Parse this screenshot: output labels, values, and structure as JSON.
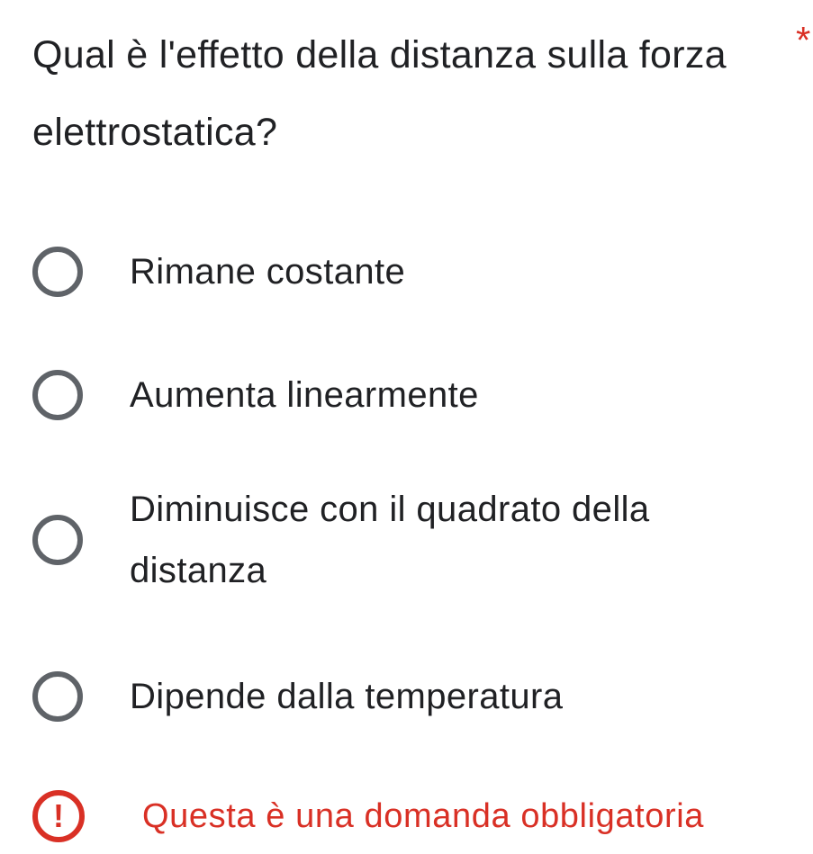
{
  "question": {
    "text": "Qual è l'effetto della distanza sulla forza elettrostatica?",
    "required_marker": "*"
  },
  "options": [
    {
      "label": "Rimane costante",
      "selected": false
    },
    {
      "label": "Aumenta linearmente",
      "selected": false
    },
    {
      "label": "Diminuisce con il quadrato della distanza",
      "selected": false
    },
    {
      "label": "Dipende dalla temperatura",
      "selected": false
    }
  ],
  "validation": {
    "icon": "alert-circle-icon",
    "icon_glyph": "!",
    "message": "Questa è una domanda obbligatoria"
  },
  "colors": {
    "error": "#d93025",
    "radio_border": "#5f6368",
    "text": "#202124"
  }
}
